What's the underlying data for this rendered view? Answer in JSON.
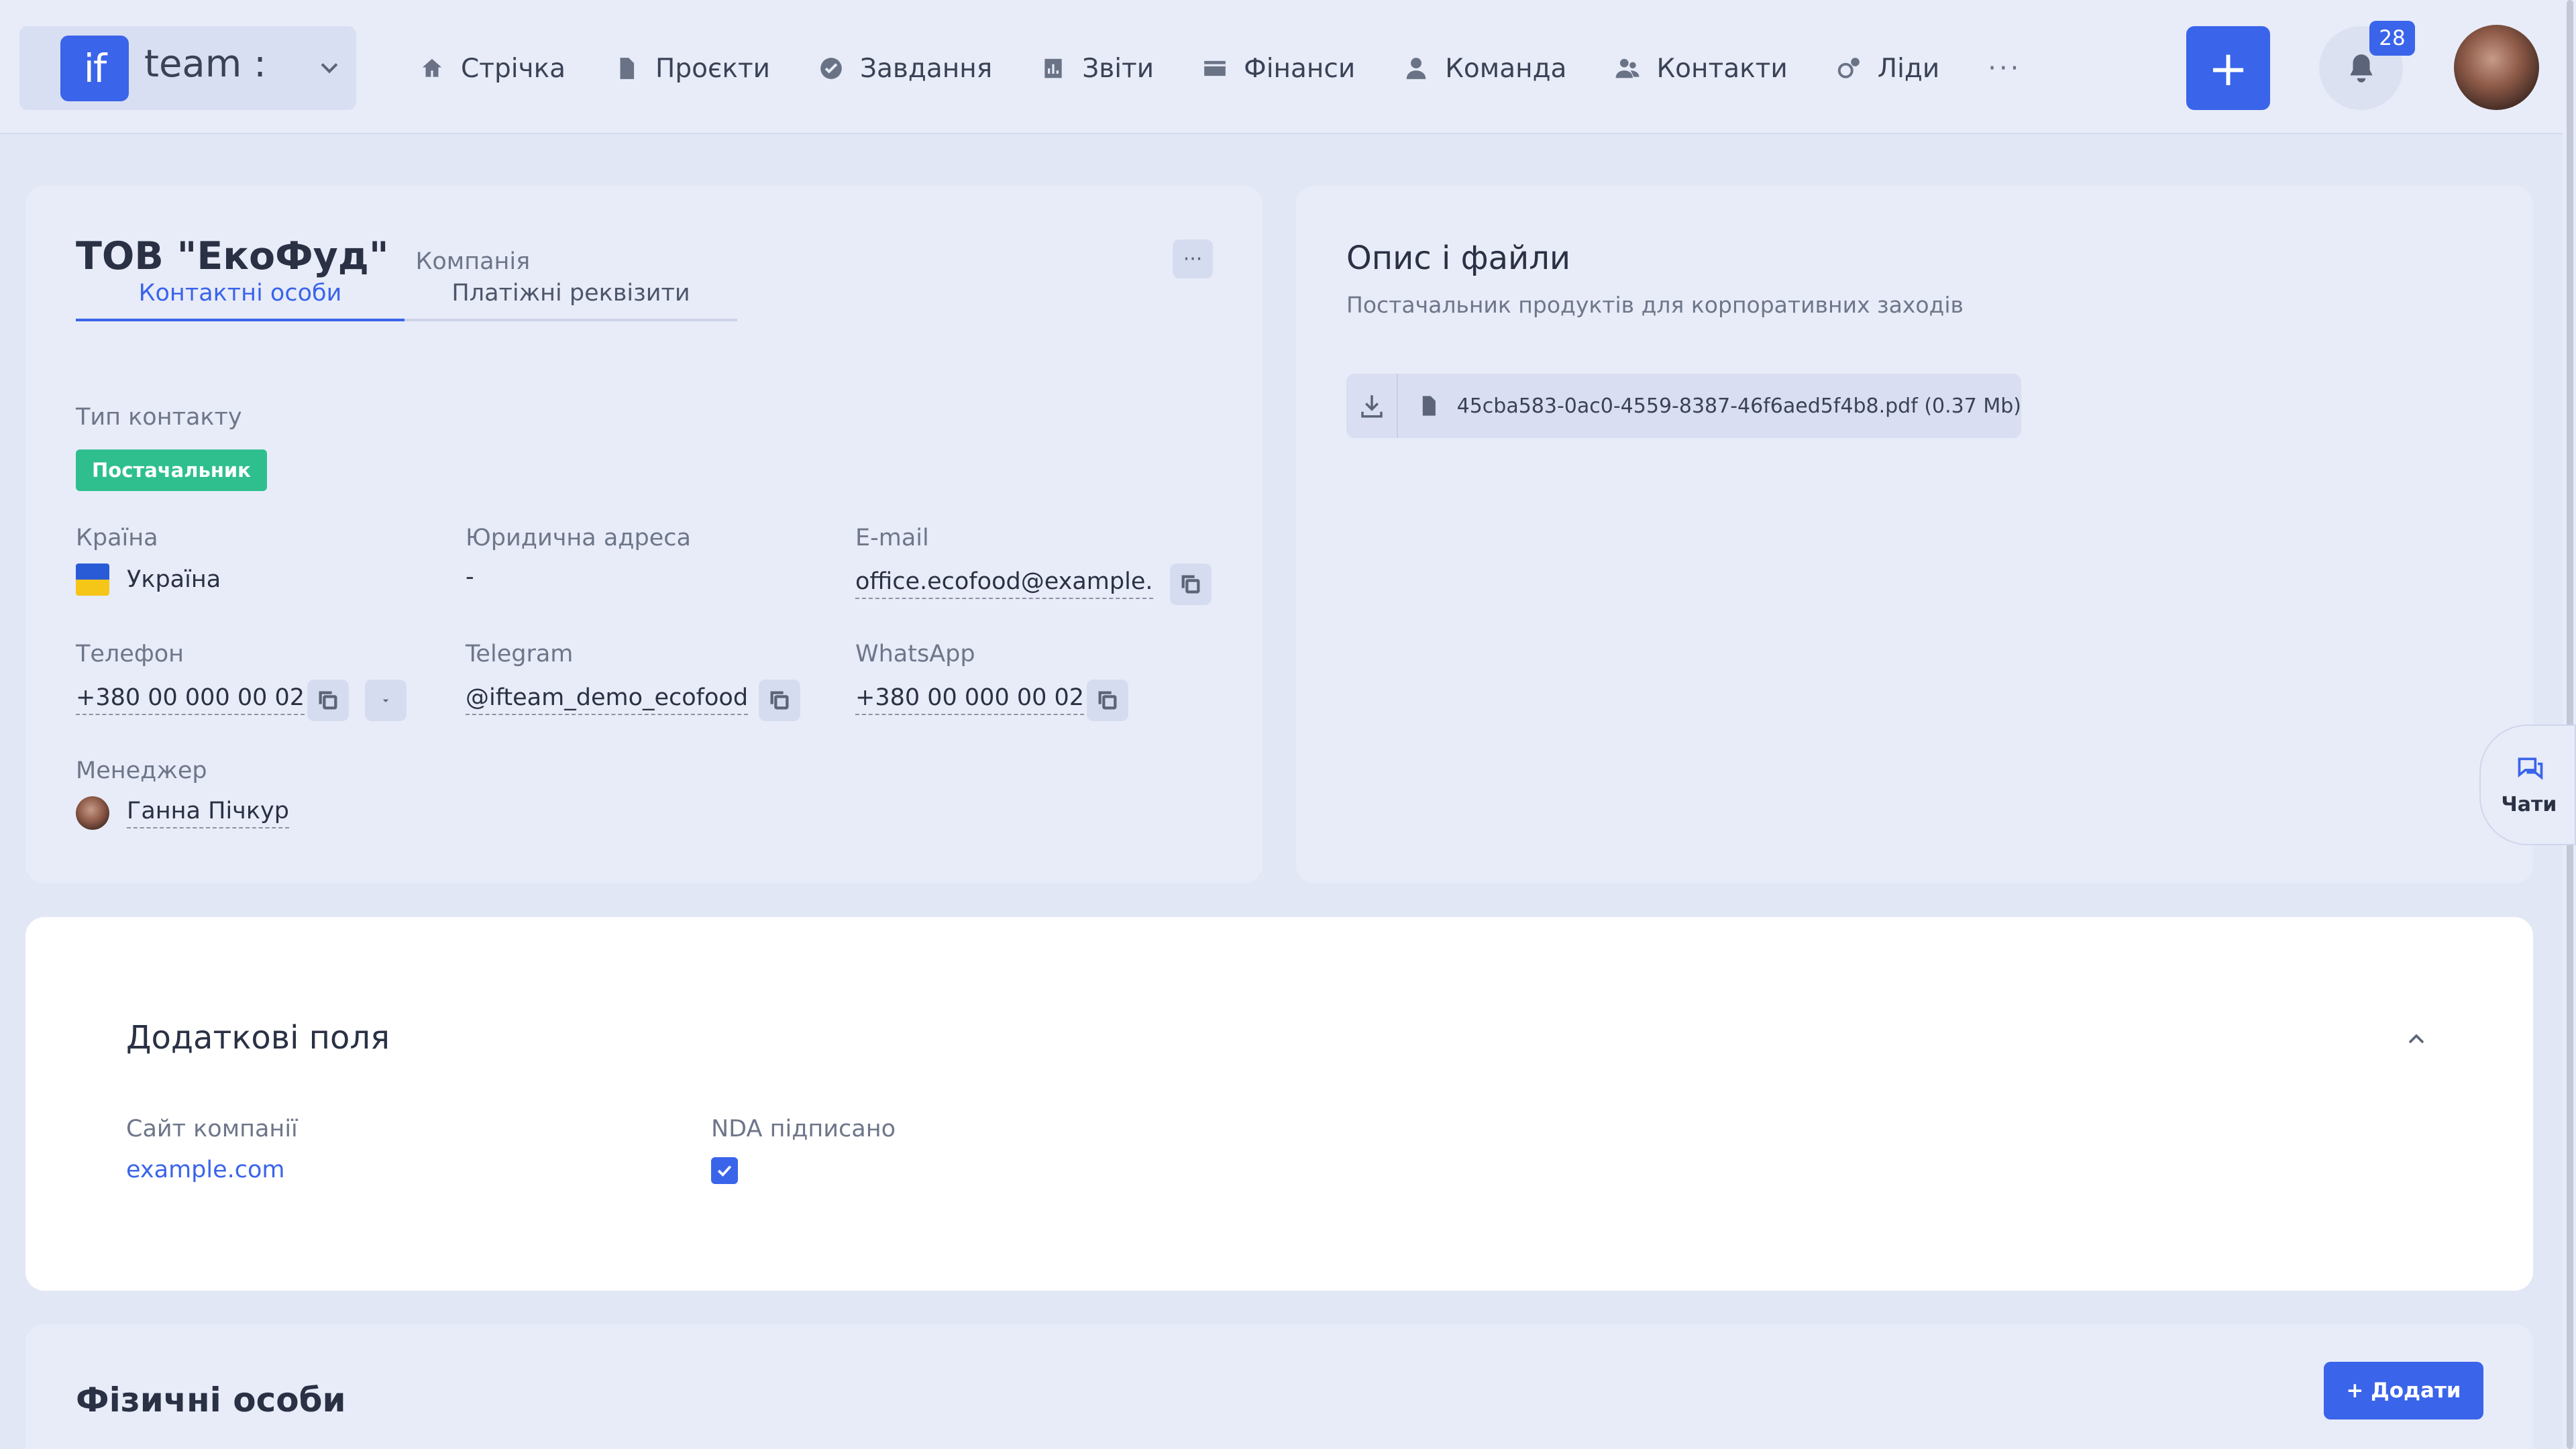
{
  "brand": {
    "logo": "if",
    "name": "team :"
  },
  "nav": [
    {
      "label": "Стрічка",
      "icon": "home-icon"
    },
    {
      "label": "Проєкти",
      "icon": "document-icon"
    },
    {
      "label": "Завдання",
      "icon": "check-circle-icon"
    },
    {
      "label": "Звіти",
      "icon": "chart-icon"
    },
    {
      "label": "Фінанси",
      "icon": "wallet-icon"
    },
    {
      "label": "Команда",
      "icon": "person-icon"
    },
    {
      "label": "Контакти",
      "icon": "people-icon"
    },
    {
      "label": "Ліди",
      "icon": "leads-icon"
    }
  ],
  "nav_more": "···",
  "add_button": "+",
  "notifications": {
    "count": "28"
  },
  "company": {
    "name": "ТОВ \"ЕкоФуд\"",
    "kind": "Компанія",
    "menu": "···",
    "tabs": [
      {
        "label": "Контактні особи"
      },
      {
        "label": "Платіжні реквізити"
      }
    ],
    "contact_type_label": "Тип контакту",
    "contact_type": "Постачальник",
    "country_label": "Країна",
    "country": "Україна",
    "legal_address_label": "Юридична адреса",
    "legal_address": "-",
    "email_label": "E-mail",
    "email": "office.ecofood@example....",
    "phone_label": "Телефон",
    "phone": "+380 00 000 00 02",
    "telegram_label": "Telegram",
    "telegram": "@ifteam_demo_ecofood",
    "whatsapp_label": "WhatsApp",
    "whatsapp": "+380 00 000 00 02",
    "manager_label": "Менеджер",
    "manager": "Ганна Пічкур"
  },
  "description": {
    "title": "Опис і файли",
    "text": "Постачальник продуктів для корпоративних заходів",
    "file": "45cba583-0ac0-4559-8387-46f6aed5f4b8.pdf (0.37 Mb)"
  },
  "chat": {
    "label": "Чати"
  },
  "extra_fields": {
    "title": "Додаткові поля",
    "site_label": "Сайт компанії",
    "site": "example.com",
    "nda_label": "NDA підписано",
    "nda_checked": true
  },
  "individuals": {
    "title": "Фізичні особи",
    "add_label": "+ Додати"
  },
  "colors": {
    "accent": "#3a64ea",
    "tag": "#2fbf8f",
    "background": "#e2e7f6"
  }
}
